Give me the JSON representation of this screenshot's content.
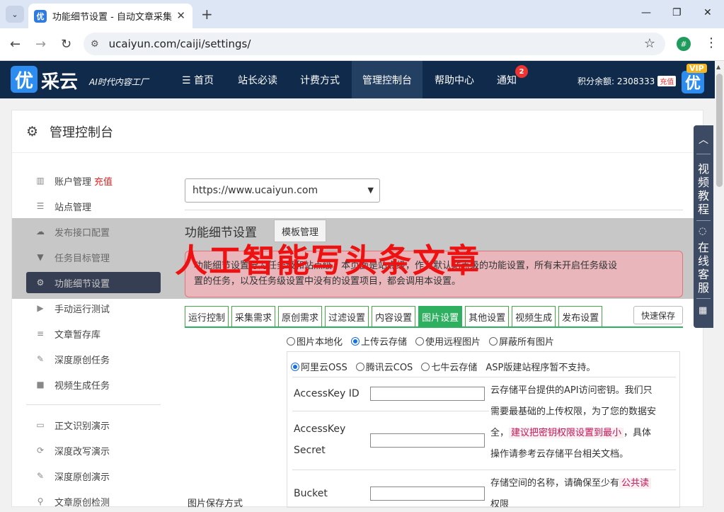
{
  "browser": {
    "tab_title": "功能细节设置 - 自动文章采集影",
    "favicon_char": "优",
    "url": "ucaiyun.com/caiji/settings/",
    "profile_char": "#"
  },
  "site": {
    "logo_char": "优",
    "logo_text": "采云",
    "logo_sub": "AI时代内容工厂",
    "nav": [
      {
        "label": "☰ 首页"
      },
      {
        "label": "站长必读"
      },
      {
        "label": "计费方式"
      },
      {
        "label": "管理控制台"
      },
      {
        "label": "帮助中心"
      },
      {
        "label": "通知"
      }
    ],
    "notify_count": "2",
    "points_text": "积分余额: 2308333",
    "recharge_tag": "充值",
    "vip_char": "优",
    "vip_tag": "VIP"
  },
  "panel": {
    "title": "管理控制台"
  },
  "sidebar": {
    "items": [
      {
        "label": "账户管理",
        "icon": "bar-chart-icon"
      },
      {
        "label": "站点管理",
        "icon": "server-icon"
      },
      {
        "label": "发布接口配置",
        "icon": "cloud-upload-icon"
      },
      {
        "label": "任务目标管理",
        "icon": "filter-icon"
      },
      {
        "label": "功能细节设置",
        "icon": "gears-icon"
      },
      {
        "label": "手动运行测试",
        "icon": "play-icon"
      },
      {
        "label": "文章暂存库",
        "icon": "database-icon"
      },
      {
        "label": "深度原创任务",
        "icon": "edit-icon"
      },
      {
        "label": "视频生成任务",
        "icon": "video-icon"
      },
      {
        "label": "正文识别演示",
        "icon": "monitor-icon"
      },
      {
        "label": "深度改写演示",
        "icon": "refresh-icon"
      },
      {
        "label": "深度原创演示",
        "icon": "edit-icon"
      },
      {
        "label": "文章原创检测",
        "icon": "search-icon"
      }
    ],
    "recharge_label": "充值"
  },
  "content": {
    "site_select": "https://www.ucaiyun.com",
    "section_title": "功能细节设置",
    "template_btn": "模板管理",
    "notice_line1": "功能细节设置分为任务级和站点级，本页面是站点级，作为默认站点级的功能设置，所有未开启任务级设",
    "notice_line2": "置的任务，以及任务级设置中没有的设置项目，都会调用本设置。",
    "overlay": "人工智能写头条文章",
    "tabs": [
      "运行控制",
      "采集需求",
      "原创需求",
      "过滤设置",
      "内容设置",
      "图片设置",
      "其他设置",
      "视频生成",
      "发布设置"
    ],
    "active_tab": 5,
    "quick_save": "快速保存",
    "image_modes": [
      "图片本地化",
      "上传云存储",
      "使用远程图片",
      "屏蔽所有图片"
    ],
    "image_mode_selected": 1,
    "storage_opts": [
      "阿里云OSS",
      "腾讯云COS",
      "七牛云存储"
    ],
    "storage_selected": 0,
    "storage_note": "ASP版建站程序暂不支持。",
    "fields": {
      "access_key_id": "AccessKey ID",
      "access_key_secret_1": "AccessKey",
      "access_key_secret_2": "Secret",
      "bucket": "Bucket"
    },
    "desc1_l1": "云存储平台提供的API访问密钥。我们只",
    "desc1_l2": "需要最基础的上传权限，为了您的数据安",
    "desc1_l3a": "全，",
    "desc1_hl": "建议把密钥权限设置到最小",
    "desc1_l3b": "，具体",
    "desc1_l4": "操作请参考云存储平台相关文档。",
    "desc2_l1a": "存储空间的名称，请确保至少有",
    "desc2_hl": "公共读",
    "desc2_l2": "权限",
    "save_mode_label": "图片保存方式"
  },
  "float": {
    "video_tutorial": "视频教程",
    "online_service": "在线客服"
  }
}
